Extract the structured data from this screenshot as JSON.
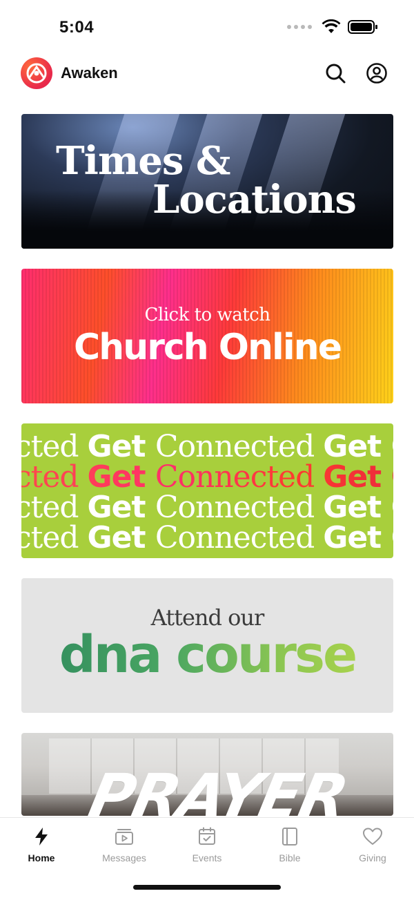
{
  "status_bar": {
    "time": "5:04"
  },
  "header": {
    "app_name": "Awaken"
  },
  "banners": {
    "times": {
      "line1": "Times &",
      "line2": "Locations"
    },
    "online": {
      "small": "Click to watch",
      "big": "Church Online"
    },
    "connected": {
      "rows": [
        {
          "a": "cted ",
          "b": "Get ",
          "c": "Connected ",
          "d": "Get ",
          "e": "C"
        },
        {
          "a": "cted ",
          "b": "Get ",
          "c": "Connected ",
          "d": "Get ",
          "e": "C"
        },
        {
          "a": "cted ",
          "b": "Get ",
          "c": "Connected ",
          "d": "Get ",
          "e": "C"
        },
        {
          "a": "cted ",
          "b": "Get ",
          "c": "Connected ",
          "d": "Get ",
          "e": "C"
        }
      ]
    },
    "dna": {
      "small": "Attend our",
      "big": "dna course"
    },
    "prayer": {
      "word": "PRAYER"
    }
  },
  "tabs": [
    {
      "label": "Home",
      "icon": "bolt-icon",
      "active": true
    },
    {
      "label": "Messages",
      "icon": "video-library-icon",
      "active": false
    },
    {
      "label": "Events",
      "icon": "calendar-check-icon",
      "active": false
    },
    {
      "label": "Bible",
      "icon": "book-icon",
      "active": false
    },
    {
      "label": "Giving",
      "icon": "heart-icon",
      "active": false
    }
  ],
  "colors": {
    "accent": "#e8284a",
    "connected_bg": "#a8cf3c",
    "dna_bg": "#e4e4e4"
  }
}
